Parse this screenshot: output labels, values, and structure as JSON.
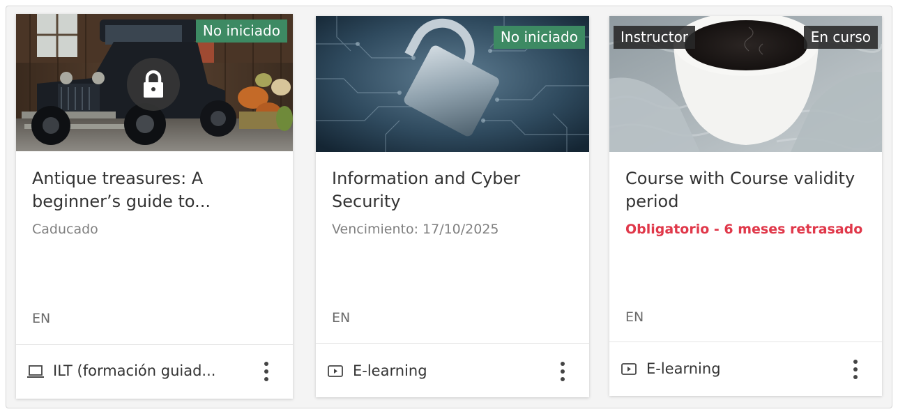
{
  "cards": [
    {
      "badges": [
        "No iniciado"
      ],
      "title": "Antique treasures: A beginner’s guide to...",
      "subtitle": "Caducado",
      "language": "EN",
      "type_label": "ILT (formación guiad...",
      "type_icon": "laptop-icon",
      "locked": true
    },
    {
      "badges": [
        "No iniciado"
      ],
      "title": "Information and Cyber Security",
      "subtitle": "Vencimiento: 17/10/2025",
      "language": "EN",
      "type_label": "E-learning",
      "type_icon": "video-play-icon",
      "locked": false
    },
    {
      "badges": [
        "Instructor",
        "En curso"
      ],
      "title": "Course with Course validity period",
      "subtitle": "Obligatorio - 6 meses retrasado",
      "language": "EN",
      "type_label": "E-learning",
      "type_icon": "video-play-icon",
      "locked": false
    }
  ],
  "colors": {
    "badge_green": "#3d8a63",
    "badge_dark": "#282828",
    "overdue_red": "#e0384a",
    "text_primary": "#333333",
    "text_muted": "#808080"
  }
}
